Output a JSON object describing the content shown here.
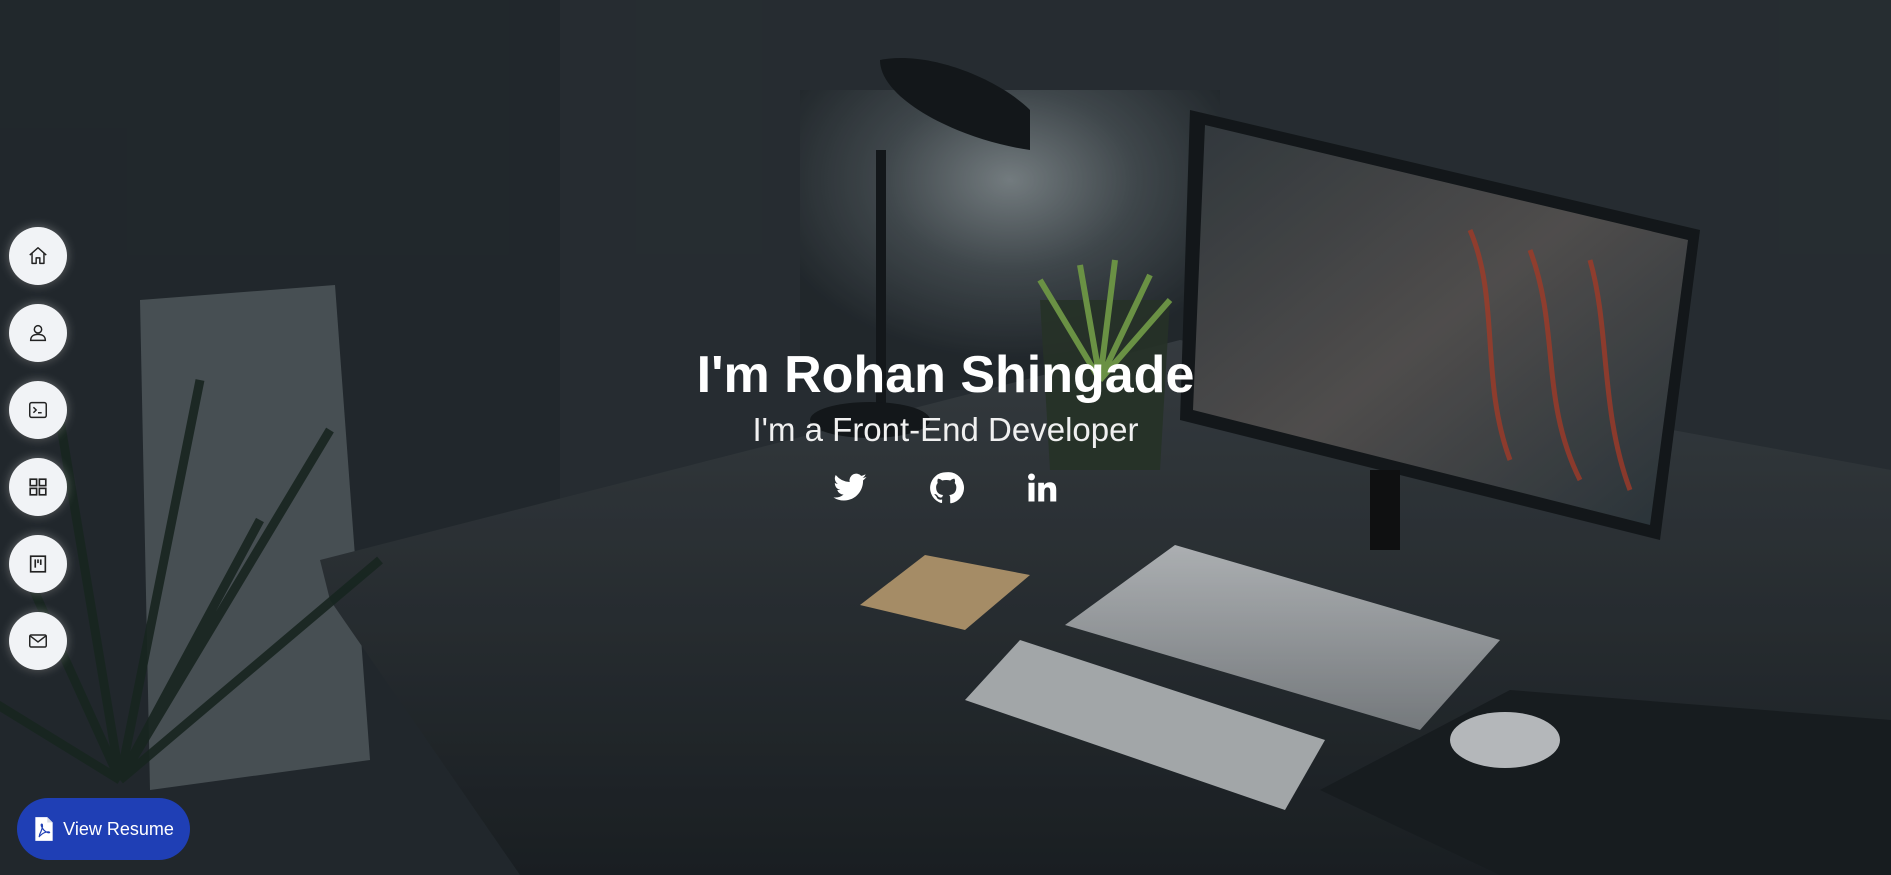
{
  "hero": {
    "title": "I'm Rohan Shingade",
    "subtitle": "I'm a Front-End Developer"
  },
  "sidenav": {
    "items": [
      {
        "name": "home",
        "icon": "home-icon"
      },
      {
        "name": "about",
        "icon": "user-icon"
      },
      {
        "name": "skills",
        "icon": "terminal-icon"
      },
      {
        "name": "projects",
        "icon": "grid-icon"
      },
      {
        "name": "experience",
        "icon": "kanban-icon"
      },
      {
        "name": "contact",
        "icon": "mail-icon"
      }
    ]
  },
  "social": {
    "items": [
      {
        "name": "twitter",
        "icon": "twitter-icon"
      },
      {
        "name": "github",
        "icon": "github-icon"
      },
      {
        "name": "linkedin",
        "icon": "linkedin-icon"
      }
    ]
  },
  "resume_button": {
    "label": "View Resume",
    "icon": "pdf-icon"
  },
  "colors": {
    "nav_button_bg": "#f1f3f6",
    "resume_button_bg": "#1f3fb5",
    "hero_text": "#ffffff"
  }
}
